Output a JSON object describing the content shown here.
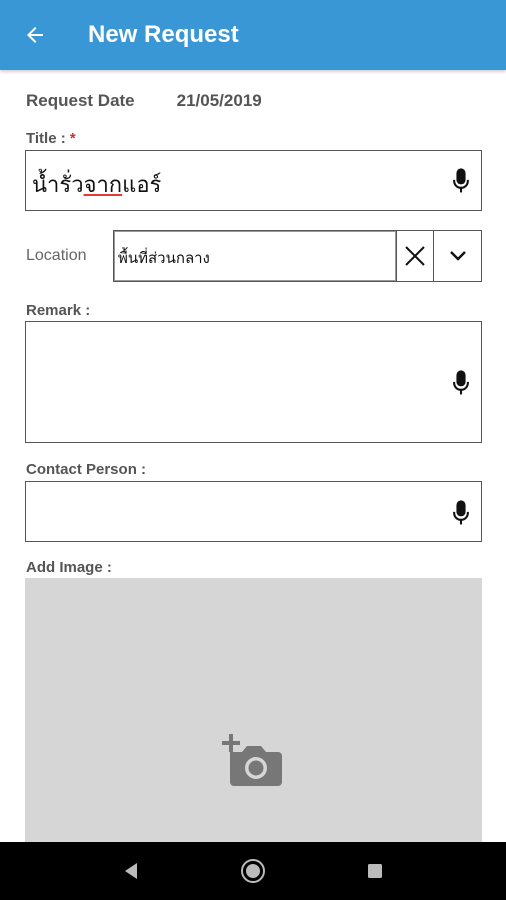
{
  "appbar": {
    "title": "New Request",
    "back_icon": "arrow-left-icon",
    "color": "#3a97d6"
  },
  "form": {
    "request_date_label": "Request Date",
    "request_date_value": "21/05/2019",
    "title_label": "Title : ",
    "title_required": "*",
    "title_value_part1": "น้ำรั่ว",
    "title_value_part2": "จาก",
    "title_value_part3": "แอร์",
    "location_label": "Location",
    "location_value": "พื้นที่ส่วนกลาง",
    "remark_label": "Remark :",
    "remark_value": "",
    "contact_label": "Contact Person :",
    "contact_value": "",
    "add_image_label": "Add Image :"
  },
  "icons": {
    "mic": "microphone-icon",
    "clear": "close-icon",
    "dropdown": "chevron-down-icon",
    "camera": "add-photo-icon"
  },
  "navbar": {
    "back": "nav-back-icon",
    "home": "nav-home-icon",
    "recents": "nav-recents-icon"
  }
}
